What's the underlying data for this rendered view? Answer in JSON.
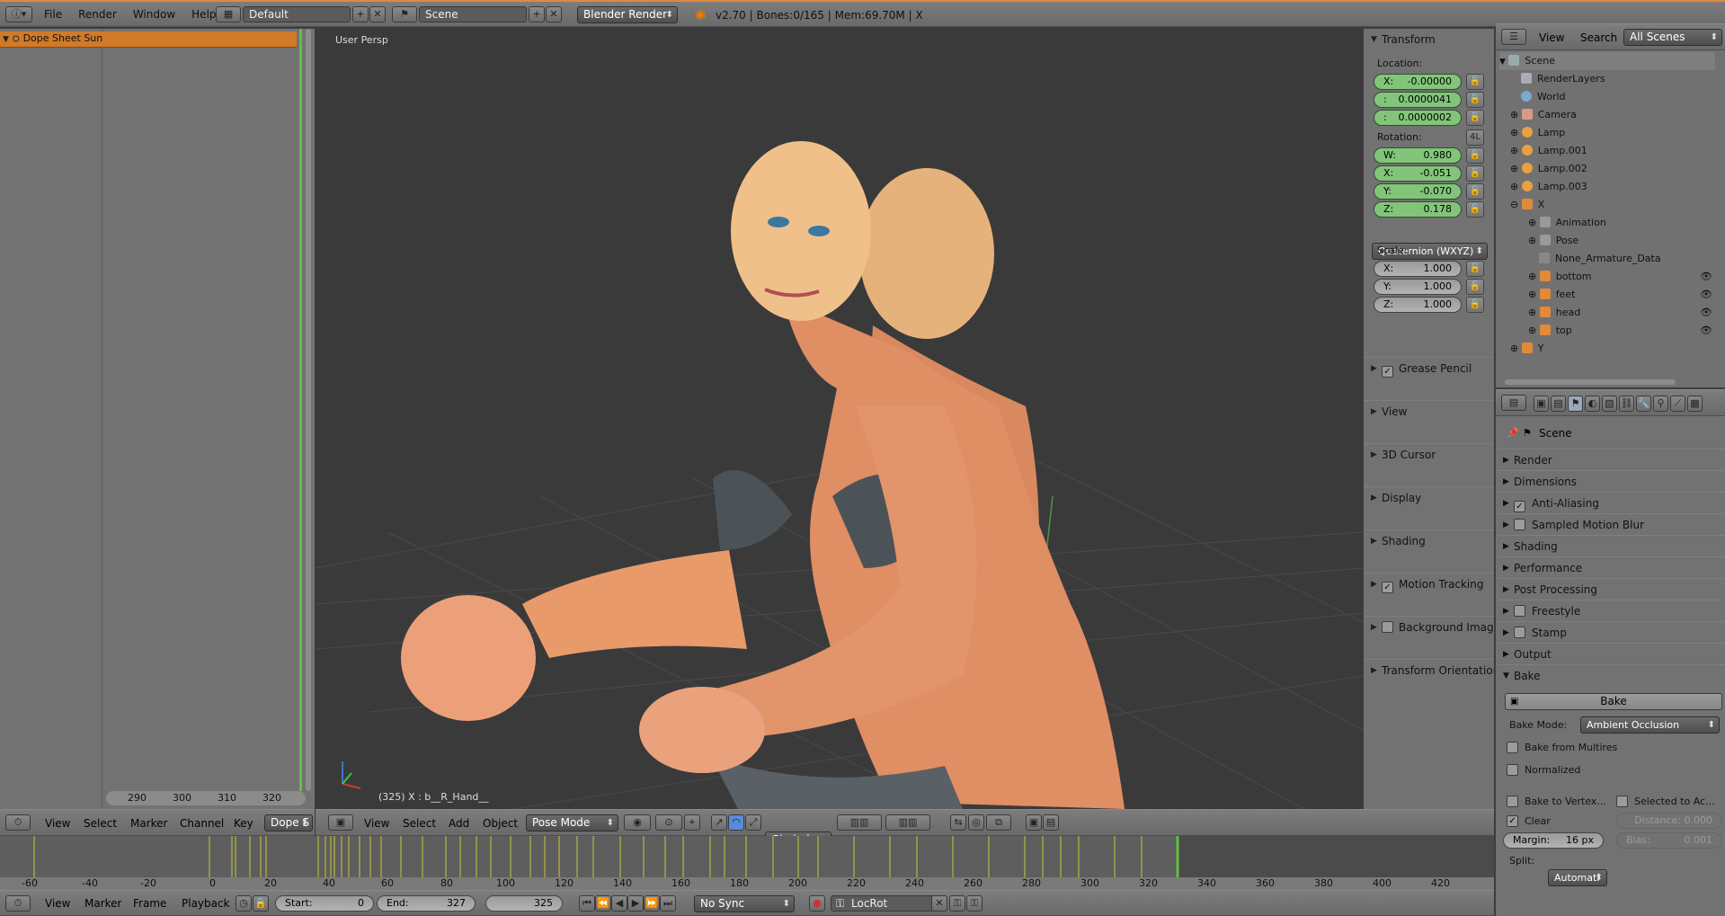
{
  "topbar": {
    "menus": [
      "File",
      "Render",
      "Window",
      "Help"
    ],
    "layout": "Default",
    "scene": "Scene",
    "engine": "Blender Render",
    "stats": "v2.70 | Bones:0/165 | Mem:69.70M | X"
  },
  "dopesheet": {
    "item": "Dope Sheet Sun",
    "ticks": [
      "290",
      "300",
      "310",
      "320"
    ],
    "menus": [
      "View",
      "Select",
      "Marker",
      "Channel",
      "Key"
    ],
    "mode": "Dope S"
  },
  "viewport": {
    "label": "User Persp",
    "status": "(325) X : b__R_Hand__",
    "menus": [
      "View",
      "Select",
      "Add",
      "Object"
    ],
    "mode": "Pose Mode",
    "orientation": "Gimbal"
  },
  "transform": {
    "title": "Transform",
    "location_label": "Location:",
    "location": [
      {
        "axis": "X:",
        "value": "-0.00000"
      },
      {
        "axis": ":",
        "value": "0.0000041"
      },
      {
        "axis": ":",
        "value": "0.0000002"
      }
    ],
    "rotation_label": "Rotation:",
    "rotation_lock": "4L",
    "rotation": [
      {
        "axis": "W:",
        "value": "0.980"
      },
      {
        "axis": "X:",
        "value": "-0.051"
      },
      {
        "axis": "Y:",
        "value": "-0.070"
      },
      {
        "axis": "Z:",
        "value": "0.178"
      }
    ],
    "rotation_mode": "Quaternion (WXYZ)",
    "scale_label": "Scale:",
    "scale": [
      {
        "axis": "X:",
        "value": "1.000"
      },
      {
        "axis": "Y:",
        "value": "1.000"
      },
      {
        "axis": "Z:",
        "value": "1.000"
      }
    ],
    "panels": [
      "Grease Pencil",
      "View",
      "3D Cursor",
      "Display",
      "Shading",
      "Motion Tracking",
      "Background Imag",
      "Transform Orientation"
    ]
  },
  "outliner": {
    "menus": [
      "View",
      "Search"
    ],
    "filter": "All Scenes",
    "rows": [
      "Scene",
      "RenderLayers",
      "World",
      "Camera",
      "Lamp",
      "Lamp.001",
      "Lamp.002",
      "Lamp.003",
      "X",
      "Animation",
      "Pose",
      "None_Armature_Data",
      "bottom",
      "feet",
      "head",
      "top",
      "Y"
    ]
  },
  "properties": {
    "context": "Scene",
    "panels": [
      "Render",
      "Dimensions",
      "Anti-Aliasing",
      "Sampled Motion Blur",
      "Shading",
      "Performance",
      "Post Processing",
      "Freestyle",
      "Stamp",
      "Output",
      "Bake"
    ],
    "bake": {
      "button": "Bake",
      "mode_label": "Bake Mode:",
      "mode": "Ambient Occlusion",
      "from_multires": "Bake from Multires",
      "normalized": "Normalized",
      "to_vertex": "Bake to Vertex...",
      "selected_to_active": "Selected to Ac...",
      "clear": "Clear",
      "distance": "Distance: 0.000",
      "margin_label": "Margin:",
      "margin": "16 px",
      "bias": "Bias:",
      "bias_value": "0.001",
      "split_label": "Split:",
      "split": "Automati"
    }
  },
  "timeline": {
    "ticks": [
      "-60",
      "-40",
      "-20",
      "0",
      "20",
      "40",
      "60",
      "80",
      "100",
      "120",
      "140",
      "160",
      "180",
      "200",
      "220",
      "240",
      "260",
      "280",
      "300",
      "320",
      "340",
      "360",
      "380",
      "400",
      "420"
    ],
    "menus": [
      "View",
      "Marker",
      "Frame",
      "Playback"
    ],
    "start_label": "Start:",
    "start": "0",
    "end_label": "End:",
    "end": "327",
    "current": "325",
    "sync": "No Sync",
    "keying": "LocRot"
  }
}
